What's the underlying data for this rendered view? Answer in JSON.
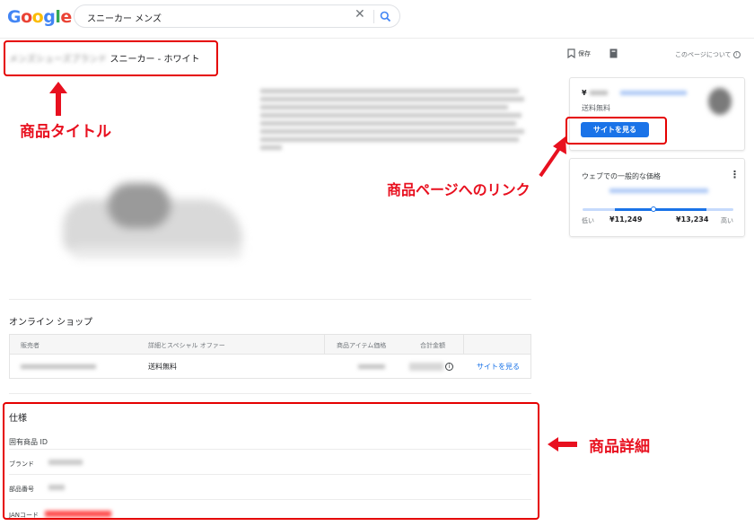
{
  "header": {
    "logo": "Google",
    "search_value": "スニーカー メンズ",
    "clear_icon": "close-icon",
    "search_icon": "search-icon"
  },
  "product": {
    "title_brand": "メンズシューズブランド",
    "title_product": "スニーカー - ホワイト"
  },
  "actions": {
    "save_label": "保存",
    "about_label": "このページについて"
  },
  "offer_card": {
    "price": "¥",
    "seller": "",
    "shipping": "送料無料",
    "button_label": "サイトを見る"
  },
  "price_card": {
    "title": "ウェブでの一般的な価格",
    "low_label": "低い",
    "low_price": "¥11,249",
    "high_price": "¥13,234",
    "high_label": "高い",
    "current_fraction": 0.5
  },
  "shops": {
    "title": "オンライン ショップ",
    "columns": [
      "販売者",
      "詳細とスペシャル オファー",
      "商品アイテム価格",
      "合計金額"
    ],
    "row": {
      "seller": "",
      "offer": "送料無料",
      "link": "サイトを見る"
    }
  },
  "specs": {
    "title": "仕様",
    "subtitle": "固有商品 ID",
    "rows": [
      {
        "label": "ブランド"
      },
      {
        "label": "部品番号"
      },
      {
        "label": "JANコード"
      }
    ]
  },
  "annotations": {
    "title_label": "商品タイトル",
    "link_label": "商品ページへのリンク",
    "detail_label": "商品詳細"
  },
  "colors": {
    "accent": "#1a73e8",
    "annotation_red": "#e8101f"
  }
}
